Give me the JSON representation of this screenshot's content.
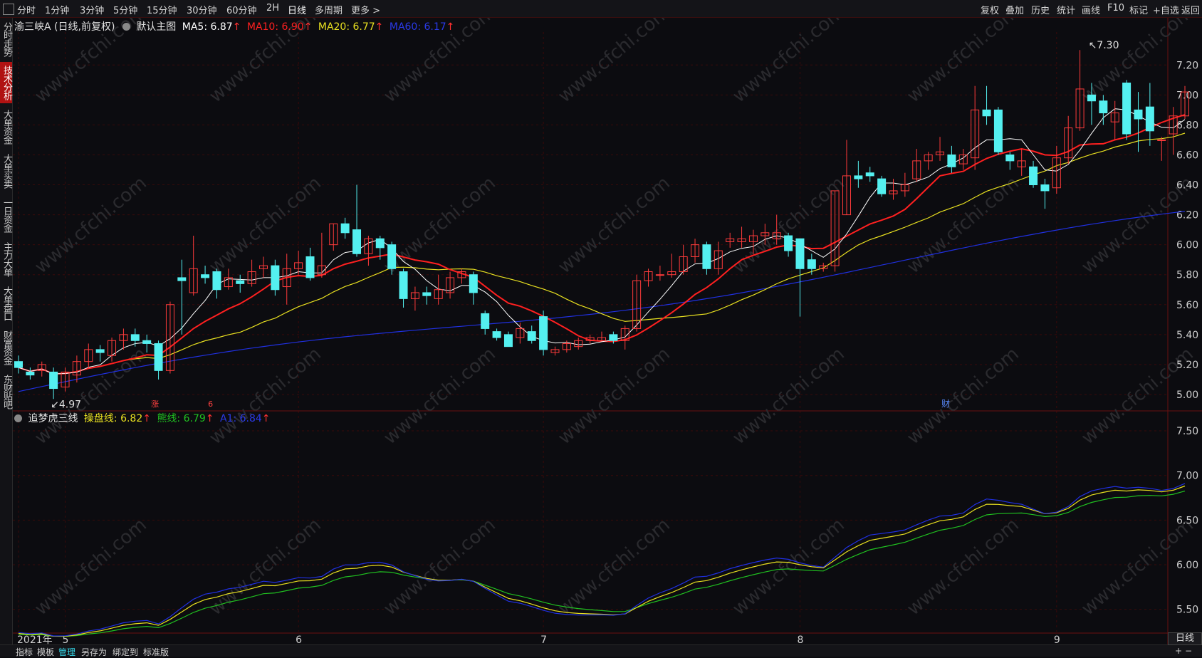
{
  "topbar": {
    "timeframes": [
      "分时",
      "1分钟",
      "3分钟",
      "5分钟",
      "15分钟",
      "30分钟",
      "60分钟",
      "2H",
      "日线",
      "多周期",
      "更多 >"
    ],
    "active_timeframe": "日线",
    "right_buttons": [
      "复权",
      "叠加",
      "历史",
      "统计",
      "画线",
      "F10",
      "标记",
      "+自选",
      "返回"
    ]
  },
  "sidebar": {
    "tabs": [
      "分时走势",
      "技术分析",
      "大单资金",
      "大单买卖",
      "一日资金",
      "主力大单",
      "大单盘口",
      "财富资金",
      "东财贴吧"
    ],
    "active": "技术分析"
  },
  "main_legend": {
    "stock": "渝三峡A (日线,前复权)",
    "template": "默认主图",
    "ma5": "MA5: 6.87",
    "ma10": "MA10: 6.90",
    "ma20": "MA20: 6.77",
    "ma60": "MA60: 6.17",
    "up_arrow": "↑"
  },
  "sub_legend": {
    "name": "追梦虎三线",
    "line1": "操盘线: 6.82",
    "line2": "熊线: 6.79",
    "line3": "A1: 6.84"
  },
  "markers": {
    "high": "7.30",
    "low": "4.97",
    "zhang": "涨",
    "six": "6",
    "cai": "财"
  },
  "watermark": "www.cfchi.com",
  "bottom_tabs": [
    "指标",
    "模板",
    "管理",
    "另存为",
    "绑定到",
    "标准版"
  ],
  "bottom_active": "管理",
  "period_label": "日线",
  "colors": {
    "up": "#ff3b3b",
    "down": "#54f0f0",
    "ma5": "#ffffff",
    "ma10": "#ff2020",
    "ma20": "#e8e020",
    "ma60": "#2030e0",
    "green": "#20c020",
    "bg": "#0c0c10",
    "grid": "#3a0a0a"
  },
  "chart_data": [
    {
      "type": "candlestick",
      "title": "渝三峡A (日线,前复权)",
      "y_ticks": [
        "7.20",
        "7.00",
        "6.80",
        "6.60",
        "6.40",
        "6.20",
        "6.00",
        "5.80",
        "5.60",
        "5.40",
        "5.20",
        "5.00"
      ],
      "ylim": [
        4.9,
        7.42
      ],
      "x_ticks": [
        {
          "label": "2021年",
          "i": 0
        },
        {
          "label": "5",
          "i": 4
        },
        {
          "label": "6",
          "i": 24
        },
        {
          "label": "7",
          "i": 45
        },
        {
          "label": "8",
          "i": 67
        },
        {
          "label": "9",
          "i": 89
        }
      ],
      "candles": [
        [
          5.22,
          5.18,
          5.26,
          5.14
        ],
        [
          5.15,
          5.13,
          5.18,
          5.1
        ],
        [
          5.16,
          5.2,
          5.22,
          5.12
        ],
        [
          5.15,
          5.04,
          5.18,
          4.97
        ],
        [
          5.05,
          5.15,
          5.18,
          5.02
        ],
        [
          5.13,
          5.22,
          5.26,
          5.08
        ],
        [
          5.22,
          5.3,
          5.34,
          5.18
        ],
        [
          5.3,
          5.28,
          5.33,
          5.22
        ],
        [
          5.26,
          5.36,
          5.38,
          5.22
        ],
        [
          5.36,
          5.4,
          5.44,
          5.3
        ],
        [
          5.4,
          5.36,
          5.44,
          5.32
        ],
        [
          5.36,
          5.34,
          5.4,
          5.28
        ],
        [
          5.34,
          5.16,
          5.36,
          5.1
        ],
        [
          5.16,
          5.6,
          5.62,
          5.14
        ],
        [
          5.78,
          5.76,
          5.9,
          5.4
        ],
        [
          5.68,
          5.84,
          6.06,
          5.66
        ],
        [
          5.8,
          5.78,
          5.86,
          5.74
        ],
        [
          5.82,
          5.7,
          5.84,
          5.64
        ],
        [
          5.72,
          5.78,
          5.84,
          5.7
        ],
        [
          5.76,
          5.74,
          5.8,
          5.68
        ],
        [
          5.74,
          5.82,
          5.9,
          5.72
        ],
        [
          5.84,
          5.86,
          5.92,
          5.78
        ],
        [
          5.86,
          5.7,
          5.9,
          5.66
        ],
        [
          5.72,
          5.84,
          5.94,
          5.6
        ],
        [
          5.84,
          5.88,
          5.96,
          5.8
        ],
        [
          5.92,
          5.78,
          5.98,
          5.76
        ],
        [
          5.8,
          5.86,
          6.08,
          5.78
        ],
        [
          6.0,
          6.14,
          6.14,
          5.96
        ],
        [
          6.14,
          6.08,
          6.18,
          6.04
        ],
        [
          6.1,
          5.94,
          6.4,
          5.92
        ],
        [
          5.94,
          6.04,
          6.06,
          5.86
        ],
        [
          6.04,
          5.98,
          6.06,
          5.9
        ],
        [
          6.0,
          5.84,
          6.02,
          5.8
        ],
        [
          5.82,
          5.64,
          5.84,
          5.58
        ],
        [
          5.64,
          5.68,
          5.72,
          5.56
        ],
        [
          5.68,
          5.66,
          5.72,
          5.6
        ],
        [
          5.64,
          5.7,
          5.8,
          5.6
        ],
        [
          5.68,
          5.78,
          5.82,
          5.64
        ],
        [
          5.78,
          5.82,
          5.84,
          5.74
        ],
        [
          5.8,
          5.68,
          5.82,
          5.6
        ],
        [
          5.54,
          5.44,
          5.56,
          5.4
        ],
        [
          5.42,
          5.38,
          5.44,
          5.36
        ],
        [
          5.4,
          5.32,
          5.42,
          5.32
        ],
        [
          5.38,
          5.44,
          5.48,
          5.34
        ],
        [
          5.42,
          5.36,
          5.46,
          5.34
        ],
        [
          5.52,
          5.3,
          5.56,
          5.26
        ],
        [
          5.28,
          5.3,
          5.32,
          5.26
        ],
        [
          5.3,
          5.34,
          5.36,
          5.28
        ],
        [
          5.32,
          5.36,
          5.38,
          5.3
        ],
        [
          5.36,
          5.38,
          5.4,
          5.34
        ],
        [
          5.36,
          5.38,
          5.42,
          5.36
        ],
        [
          5.4,
          5.36,
          5.42,
          5.34
        ],
        [
          5.36,
          5.44,
          5.46,
          5.3
        ],
        [
          5.44,
          5.76,
          5.8,
          5.42
        ],
        [
          5.76,
          5.82,
          5.84,
          5.72
        ],
        [
          5.8,
          5.8,
          5.86,
          5.76
        ],
        [
          5.8,
          5.82,
          5.94,
          5.78
        ],
        [
          5.82,
          5.92,
          6.0,
          5.8
        ],
        [
          5.92,
          6.0,
          6.04,
          5.88
        ],
        [
          6.0,
          5.84,
          6.02,
          5.8
        ],
        [
          5.84,
          5.96,
          6.02,
          5.8
        ],
        [
          6.02,
          6.04,
          6.08,
          5.98
        ],
        [
          6.02,
          6.04,
          6.12,
          5.98
        ],
        [
          6.02,
          6.06,
          6.1,
          5.94
        ],
        [
          6.06,
          6.08,
          6.14,
          6.0
        ],
        [
          6.04,
          6.08,
          6.2,
          6.0
        ],
        [
          6.06,
          5.96,
          6.08,
          5.92
        ],
        [
          6.04,
          5.84,
          6.04,
          5.52
        ],
        [
          5.9,
          5.84,
          5.94,
          5.8
        ],
        [
          5.84,
          5.86,
          5.88,
          5.82
        ],
        [
          5.86,
          6.36,
          6.36,
          5.82
        ],
        [
          6.2,
          6.46,
          6.7,
          6.2
        ],
        [
          6.46,
          6.44,
          6.56,
          6.38
        ],
        [
          6.48,
          6.46,
          6.52,
          6.42
        ],
        [
          6.44,
          6.34,
          6.46,
          6.32
        ],
        [
          6.34,
          6.36,
          6.44,
          6.3
        ],
        [
          6.36,
          6.4,
          6.48,
          6.32
        ],
        [
          6.44,
          6.56,
          6.64,
          6.42
        ],
        [
          6.56,
          6.6,
          6.62,
          6.5
        ],
        [
          6.6,
          6.62,
          6.72,
          6.56
        ],
        [
          6.6,
          6.52,
          6.66,
          6.48
        ],
        [
          6.54,
          6.6,
          6.64,
          6.5
        ],
        [
          6.58,
          6.9,
          7.06,
          6.5
        ],
        [
          6.9,
          6.86,
          7.06,
          6.8
        ],
        [
          6.9,
          6.62,
          6.92,
          6.6
        ],
        [
          6.6,
          6.56,
          6.62,
          6.5
        ],
        [
          6.52,
          6.56,
          6.64,
          6.46
        ],
        [
          6.52,
          6.4,
          6.56,
          6.38
        ],
        [
          6.4,
          6.36,
          6.44,
          6.24
        ],
        [
          6.38,
          6.58,
          6.66,
          6.34
        ],
        [
          6.58,
          6.78,
          6.86,
          6.54
        ],
        [
          6.78,
          7.04,
          7.3,
          6.76
        ],
        [
          7.0,
          6.96,
          7.08,
          6.8
        ],
        [
          6.96,
          6.88,
          7.0,
          6.8
        ],
        [
          6.82,
          6.88,
          6.96,
          6.7
        ],
        [
          7.08,
          6.74,
          7.1,
          6.7
        ],
        [
          6.9,
          6.84,
          7.02,
          6.62
        ],
        [
          6.92,
          6.76,
          7.08,
          6.66
        ],
        [
          6.7,
          6.7,
          6.72,
          6.56
        ],
        [
          6.74,
          6.86,
          6.92,
          6.6
        ],
        [
          6.86,
          7.02,
          7.06,
          6.84
        ]
      ],
      "ma5_last": 6.87,
      "ma10_last": 6.9,
      "ma20_last": 6.77,
      "ma60_last": 6.17
    },
    {
      "type": "line",
      "title": "追梦虎三线",
      "y_ticks": [
        "7.50",
        "7.00",
        "6.50",
        "6.00",
        "5.50"
      ],
      "ylim": [
        5.25,
        7.7
      ],
      "series": [
        {
          "name": "操盘线",
          "color": "#e8e020",
          "last": 6.82
        },
        {
          "name": "熊线",
          "color": "#20c020",
          "last": 6.79
        },
        {
          "name": "A1",
          "color": "#2030e0",
          "last": 6.84
        }
      ]
    }
  ]
}
